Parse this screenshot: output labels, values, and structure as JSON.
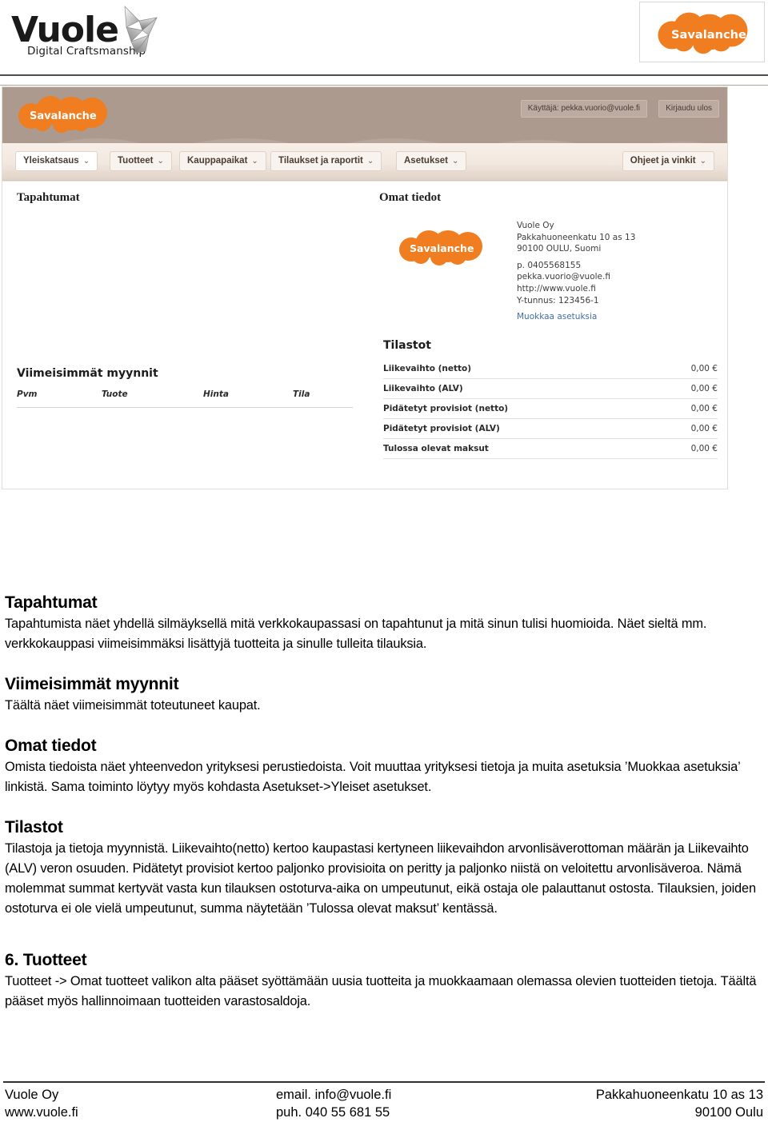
{
  "brand": {
    "logo_word": "Vuole",
    "logo_tagline": "Digital Craftsmanship",
    "partner_logo_text": "Savalanche",
    "accent_orange": "#f07d20",
    "header_brown": "#ac9a8f"
  },
  "screenshot": {
    "app_logo_text": "Savalanche",
    "user_label": "Käyttäjä: pekka.vuorio@vuole.fi",
    "logout_label": "Kirjaudu ulos",
    "nav": [
      {
        "label": "Yleiskatsaus",
        "caret": "chevron-down-icon",
        "active": true
      },
      {
        "label": "Tuotteet",
        "caret": "chevron-down-icon",
        "active": false
      },
      {
        "label": "Kauppapaikat",
        "caret": "chevron-down-icon",
        "active": false
      },
      {
        "label": "Tilaukset ja raportit",
        "caret": "chevron-down-icon",
        "active": false
      },
      {
        "label": "Asetukset",
        "caret": "chevron-down-icon",
        "active": false
      }
    ],
    "nav_right": {
      "label": "Ohjeet ja vinkit",
      "caret": "chevron-down-icon"
    },
    "panels": {
      "tapahtumat_title": "Tapahtumat",
      "omat_tiedot_title": "Omat tiedot",
      "company": {
        "name": "Vuole Oy",
        "street": "Pakkahuoneenkatu 10 as 13",
        "city": "90100 OULU, Suomi",
        "phone": "p. 0405568155",
        "email": "pekka.vuorio@vuole.fi",
        "web": "http://www.vuole.fi",
        "vat": "Y-tunnus: 123456-1",
        "edit_link": "Muokkaa asetuksia"
      },
      "viimeisimmat_title": "Viimeisimmät myynnit",
      "sales_columns": [
        "Pvm",
        "Tuote",
        "Hinta",
        "Tila"
      ],
      "tilastot_title": "Tilastot",
      "stats": [
        {
          "label": "Liikevaihto (netto)",
          "value": "0,00 €"
        },
        {
          "label": "Liikevaihto (ALV)",
          "value": "0,00 €"
        },
        {
          "label": "Pidätetyt provisiot (netto)",
          "value": "0,00 €"
        },
        {
          "label": "Pidätetyt provisiot (ALV)",
          "value": "0,00 €"
        },
        {
          "label": "Tulossa olevat maksut",
          "value": "0,00 €"
        }
      ]
    }
  },
  "doc": {
    "s1": {
      "heading": "Tapahtumat",
      "body": "Tapahtumista näet yhdellä silmäyksellä mitä verkkokaupassasi on tapahtunut  ja mitä sinun tulisi huomioida. Näet sieltä mm. verkkokauppasi viimeisimmäksi lisättyjä tuotteita ja sinulle tulleita tilauksia."
    },
    "s2": {
      "heading": "Viimeisimmät myynnit",
      "body": "Täältä näet viimeisimmät toteutuneet kaupat."
    },
    "s3": {
      "heading": "Omat tiedot",
      "body": "Omista tiedoista näet yhteenvedon yrityksesi perustiedoista. Voit muuttaa yrityksesi tietoja ja muita asetuksia ’Muokkaa asetuksia’ linkistä. Sama toiminto löytyy myös kohdasta Asetukset->Yleiset asetukset."
    },
    "s4": {
      "heading": "Tilastot",
      "body": "Tilastoja ja tietoja myynnistä. Liikevaihto(netto) kertoo kaupastasi kertyneen liikevaihdon arvonlisäverottoman määrän ja Liikevaihto (ALV) veron osuuden. Pidätetyt provisiot kertoo paljonko provisioita on peritty ja paljonko niistä on veloitettu arvonlisäveroa.  Nämä molemmat summat kertyvät vasta kun tilauksen ostoturva-aika on umpeutunut, eikä ostaja ole palauttanut ostosta. Tilauksien, joiden ostoturva ei ole vielä umpeutunut, summa näytetään ’Tulossa olevat maksut’ kentässä."
    },
    "s5": {
      "heading": "6.  Tuotteet",
      "body": "Tuotteet -> Omat tuotteet valikon alta pääset syöttämään uusia tuotteita ja muokkaamaan olemassa olevien tuotteiden tietoja. Täältä pääset myös hallinnoimaan tuotteiden varastosaldoja."
    }
  },
  "footer": {
    "col1_line1": "Vuole Oy",
    "col1_line2": "www.vuole.fi",
    "col2_line1": "email. info@vuole.fi",
    "col2_line2": "puh. 040 55 681 55",
    "col3_line1": "Pakkahuoneenkatu 10 as 13",
    "col3_line2": "90100 Oulu"
  }
}
